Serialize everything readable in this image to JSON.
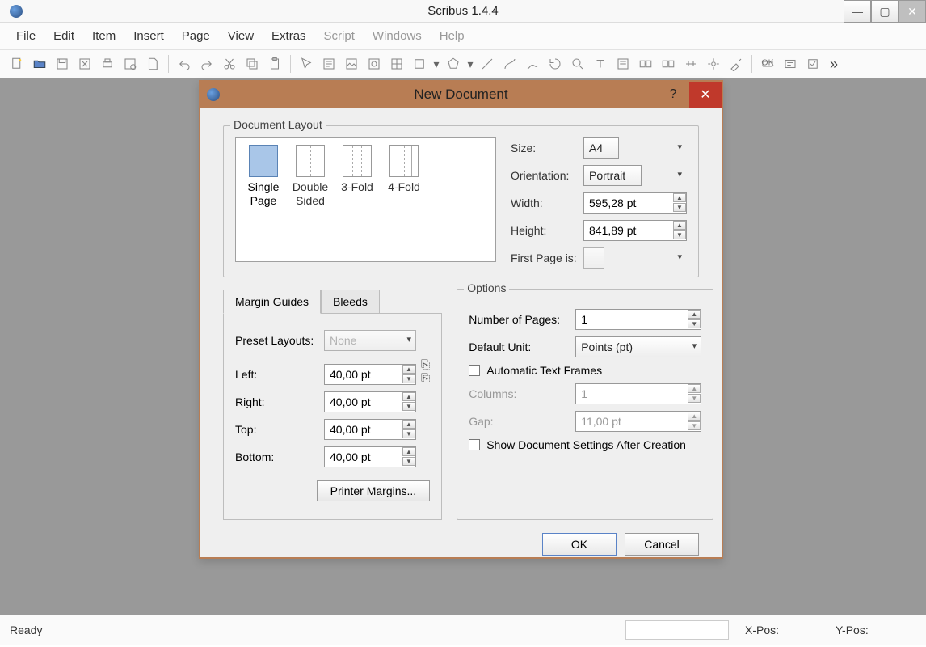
{
  "app": {
    "title": "Scribus 1.4.4"
  },
  "menu": {
    "items": [
      "File",
      "Edit",
      "Item",
      "Insert",
      "Page",
      "View",
      "Extras",
      "Script",
      "Windows",
      "Help"
    ]
  },
  "statusbar": {
    "ready": "Ready",
    "xpos": "X-Pos:",
    "ypos": "Y-Pos:"
  },
  "dialog": {
    "title": "New Document",
    "doclayout_legend": "Document Layout",
    "layouts": {
      "single": "Single Page",
      "double": "Double Sided",
      "f3": "3-Fold",
      "f4": "4-Fold"
    },
    "size_lbl": "Size:",
    "size_val": "A4",
    "orient_lbl": "Orientation:",
    "orient_val": "Portrait",
    "width_lbl": "Width:",
    "width_val": "595,28 pt",
    "height_lbl": "Height:",
    "height_val": "841,89 pt",
    "firstpage_lbl": "First Page is:",
    "firstpage_val": "",
    "tab_margin": "Margin Guides",
    "tab_bleeds": "Bleeds",
    "preset_lbl": "Preset Layouts:",
    "preset_val": "None",
    "left_lbl": "Left:",
    "left_val": "40,00 pt",
    "right_lbl": "Right:",
    "right_val": "40,00 pt",
    "top_lbl": "Top:",
    "top_val": "40,00 pt",
    "bottom_lbl": "Bottom:",
    "bottom_val": "40,00 pt",
    "printer_margins": "Printer Margins...",
    "options_legend": "Options",
    "numpages_lbl": "Number of Pages:",
    "numpages_val": "1",
    "unit_lbl": "Default Unit:",
    "unit_val": "Points (pt)",
    "autotf": "Automatic Text Frames",
    "columns_lbl": "Columns:",
    "columns_val": "1",
    "gap_lbl": "Gap:",
    "gap_val": "11,00 pt",
    "showsettings": "Show Document Settings After Creation",
    "ok": "OK",
    "cancel": "Cancel"
  }
}
